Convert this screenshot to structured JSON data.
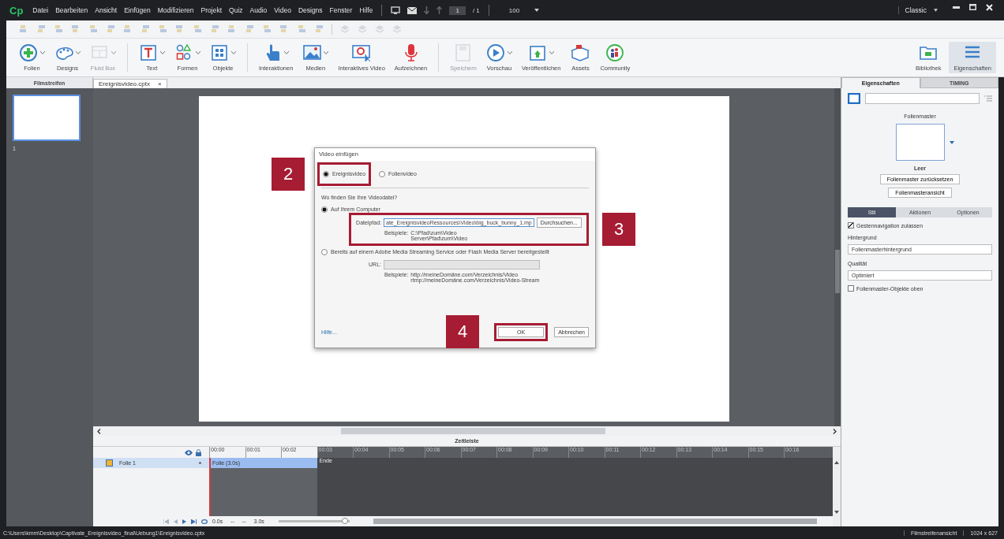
{
  "app": {
    "logo": "Cp",
    "menu": [
      "Datei",
      "Bearbeiten",
      "Ansicht",
      "Einfügen",
      "Modifizieren",
      "Projekt",
      "Quiz",
      "Audio",
      "Video",
      "Designs",
      "Fenster",
      "Hilfe"
    ],
    "page_current": "1",
    "page_total": "/ 1",
    "zoom": "100",
    "workspace": "Classic"
  },
  "main_toolbar": {
    "groups": [
      [
        {
          "label": "Folien",
          "dropdown": true,
          "disabled": false
        },
        {
          "label": "Designs",
          "dropdown": true,
          "disabled": false
        },
        {
          "label": "Fluid Box",
          "dropdown": true,
          "disabled": true
        }
      ],
      [
        {
          "label": "Text",
          "dropdown": true,
          "disabled": false
        },
        {
          "label": "Formen",
          "dropdown": true,
          "disabled": false
        },
        {
          "label": "Objekte",
          "dropdown": true,
          "disabled": false
        }
      ],
      [
        {
          "label": "Interaktionen",
          "dropdown": true,
          "disabled": false
        },
        {
          "label": "Medien",
          "dropdown": true,
          "disabled": false
        },
        {
          "label": "Interaktives Video",
          "dropdown": false,
          "disabled": false
        },
        {
          "label": "Aufzeichnen",
          "dropdown": false,
          "disabled": false
        }
      ],
      [
        {
          "label": "Speichern",
          "dropdown": false,
          "disabled": true
        },
        {
          "label": "Vorschau",
          "dropdown": true,
          "disabled": false
        },
        {
          "label": "Veröffentlichen",
          "dropdown": true,
          "disabled": false
        },
        {
          "label": "Assets",
          "dropdown": false,
          "disabled": false
        },
        {
          "label": "Community",
          "dropdown": false,
          "disabled": false
        }
      ]
    ],
    "right": [
      {
        "label": "Bibliothek",
        "selected": false
      },
      {
        "label": "Eigenschaften",
        "selected": true
      }
    ]
  },
  "filmstrip": {
    "title": "Filmstreifen",
    "slides": [
      {
        "number": "1",
        "selected": true
      }
    ]
  },
  "document_tab": {
    "title": "Ereignisvideo.cptx",
    "close": "×"
  },
  "dialog": {
    "title": "Video einfügen",
    "types": [
      {
        "label": "Ereignisvideo",
        "selected": true
      },
      {
        "label": "Folienvideo",
        "selected": false
      }
    ],
    "question": "Wo finden Sie Ihre Videodatei?",
    "sources": [
      {
        "kind": "file",
        "label": "Auf Ihrem Computer",
        "selected": true,
        "field_label": "Dateipfad:",
        "value": "ate_EreignisvideoRessources\\Video\\big_buck_bunny_1.mp",
        "button": "Durchsuchen...",
        "examples_label": "Beispiele:",
        "examples": [
          "C:\\Pfad\\zum\\Video",
          "Server\\Pfad\\zum\\Video"
        ]
      },
      {
        "kind": "url",
        "label": "Bereits auf einem Adobe Media Streaming Service oder Flash Media Server bereitgestellt",
        "selected": false,
        "field_label": "URL:",
        "examples_label": "Beispiele:",
        "examples": [
          "http://meineDomäne.com/Verzeichnis/Video",
          "rtmp://meineDomäne.com/Verzeichnis/Video-Stream"
        ]
      }
    ],
    "help": "Hilfe...",
    "ok": "OK",
    "cancel": "Abbrechen"
  },
  "callouts": [
    {
      "number": "2"
    },
    {
      "number": "3"
    },
    {
      "number": "4"
    }
  ],
  "properties": {
    "tabs": [
      {
        "label": "Eigenschaften",
        "selected": true
      },
      {
        "label": "TIMING",
        "selected": false
      }
    ],
    "master_title": "Folienmaster",
    "master_name": "Leer",
    "buttons": [
      "Folienmaster zurücksetzen",
      "Folienmasteransicht"
    ],
    "subtabs": [
      {
        "label": "Stil",
        "selected": true
      },
      {
        "label": "Aktionen",
        "selected": false
      },
      {
        "label": "Optionen",
        "selected": false
      }
    ],
    "gesture": {
      "label": "Gestennavigation zulassen",
      "checked": true
    },
    "background_label": "Hintergrund",
    "background": "Folienmasterhintergrund",
    "quality_label": "Qualität",
    "quality": "Optimiert",
    "objects_on_top": {
      "label": "Folienmaster-Objekte oben",
      "checked": false
    }
  },
  "timeline": {
    "title": "Zeitleiste",
    "ticks": [
      "00:00",
      "00:01",
      "00:02",
      "00:03",
      "00:04",
      "00:05",
      "00:06",
      "00:07",
      "00:08",
      "00:09",
      "00:10",
      "00:11",
      "00:12",
      "00:13",
      "00:14",
      "00:15",
      "00:16"
    ],
    "layers": [
      {
        "name": "Folie 1",
        "bar": "Folie (3.0s)",
        "end": "Ende"
      }
    ],
    "start_time": "0.0s",
    "in_time": "--",
    "out_time": "--",
    "duration": "3.0s",
    "zoom": {
      "level": 0.93
    }
  },
  "status_bar": {
    "path": "C:\\Users\\kmm\\Desktop\\Captivate_Ereignisvideo_final\\Uebung1\\Ereignisvideo.cptx",
    "view": "Filmstreifenansicht",
    "size": "1024 x 627"
  }
}
